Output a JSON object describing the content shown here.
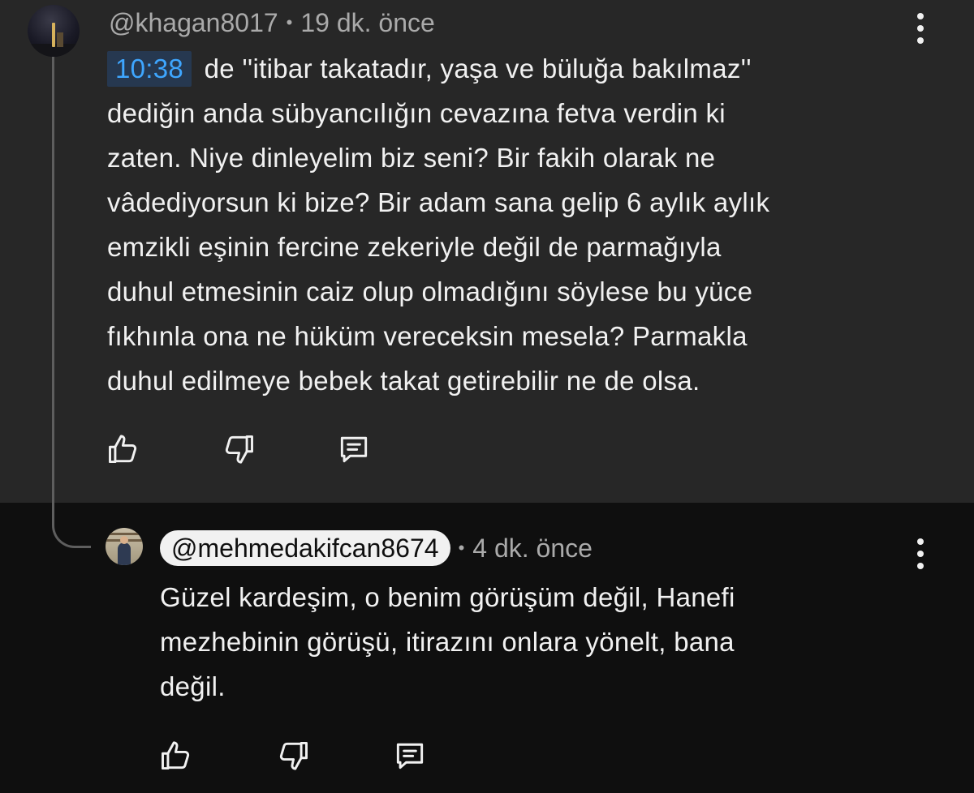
{
  "comment": {
    "author": "@khagan8017",
    "separator": "•",
    "time_ago": "19 dk. önce",
    "timestamp_link": "10:38",
    "lines": [
      "de ''itibar takatadır, yaşa ve büluğa bakılmaz''",
      "dediğin anda sübyancılığın cevazına fetva verdin ki",
      "zaten. Niye dinleyelim biz seni? Bir fakih olarak ne",
      "vâdediyorsun ki bize? Bir adam sana gelip 6 aylık aylık",
      "emzikli eşinin fercine zekeriyle değil de parmağıyla",
      "duhul etmesinin caiz olup olmadığını söylese bu yüce",
      "fıkhınla ona ne hüküm vereceksin mesela? Parmakla",
      "duhul edilmeye bebek takat getirebilir ne de olsa."
    ],
    "actions": {
      "like_icon": "thumbs-up-icon",
      "dislike_icon": "thumbs-down-icon",
      "reply_icon": "reply-comment-icon"
    }
  },
  "reply": {
    "author": "@mehmedakifcan8674",
    "separator": "•",
    "time_ago": "4 dk. önce",
    "lines": [
      "Güzel kardeşim, o benim görüşüm değil, Hanefi",
      "mezhebinin görüşü, itirazını onlara yönelt, bana",
      "değil."
    ],
    "actions": {
      "like_icon": "thumbs-up-icon",
      "dislike_icon": "thumbs-down-icon",
      "reply_icon": "reply-comment-icon"
    }
  },
  "colors": {
    "highlight_background": "#272727",
    "page_background": "#0f0f0f",
    "primary_text": "#f1f1f1",
    "secondary_text": "#aaaaaa",
    "timestamp_link": "#3ea6ff",
    "timestamp_background": "#263850",
    "thread_line": "#5e5e5e"
  }
}
